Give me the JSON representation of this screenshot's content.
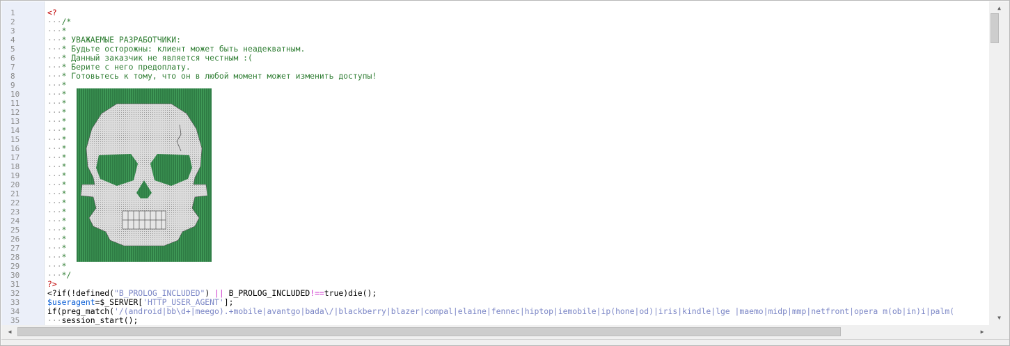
{
  "gutter": {
    "line_numbers": [
      "1",
      "2",
      "3",
      "4",
      "5",
      "6",
      "7",
      "8",
      "9",
      "10",
      "11",
      "12",
      "13",
      "14",
      "15",
      "16",
      "17",
      "18",
      "19",
      "20",
      "21",
      "22",
      "23",
      "24",
      "25",
      "26",
      "27",
      "28",
      "29",
      "30",
      "31",
      "32",
      "33",
      "34",
      "35"
    ]
  },
  "code": {
    "line1": "<?",
    "ws": "···",
    "line2": "/*",
    "star": "*",
    "line4": "* УВАЖАЕМЫЕ РАЗРАБОТЧИКИ:",
    "line5": "* Будьте осторожны: клиент может быть неадекватным.",
    "line6": "* Данный заказчик не является честным :(",
    "line7": "* Берите с него предоплату.",
    "line8": "* Готовьтесь к тому, что он в любой момент может изменить доступы!",
    "line30": "*/",
    "line31": "?>",
    "line32": {
      "a": "<?if(!defined(",
      "b": "\"B_PROLOG_INCLUDED\"",
      "c": ") ",
      "d": "||",
      "e": " B_PROLOG_INCLUDED",
      "f": "!==",
      "g": "true)die();"
    },
    "line33": {
      "a": "$useragent",
      "b": "=$_SERVER[",
      "c": "'HTTP_USER_AGENT'",
      "d": "];"
    },
    "line34": {
      "a": "if(preg_match(",
      "b": "'/(android|bb\\d+|meego).+mobile|avantgo|bada\\/|blackberry|blazer|compal|elaine|fennec|hiptop|iemobile|ip(hone|od)|iris|kindle|lge |maemo|midp|mmp|netfront|opera m(ob|in)i|palm("
    },
    "line35": "session_start();"
  },
  "colors": {
    "gutter_bg": "#ebeff9",
    "comment": "#2e7d32",
    "skull_bg": "#2f7d45",
    "skull_fg": "#d8d8d8"
  }
}
